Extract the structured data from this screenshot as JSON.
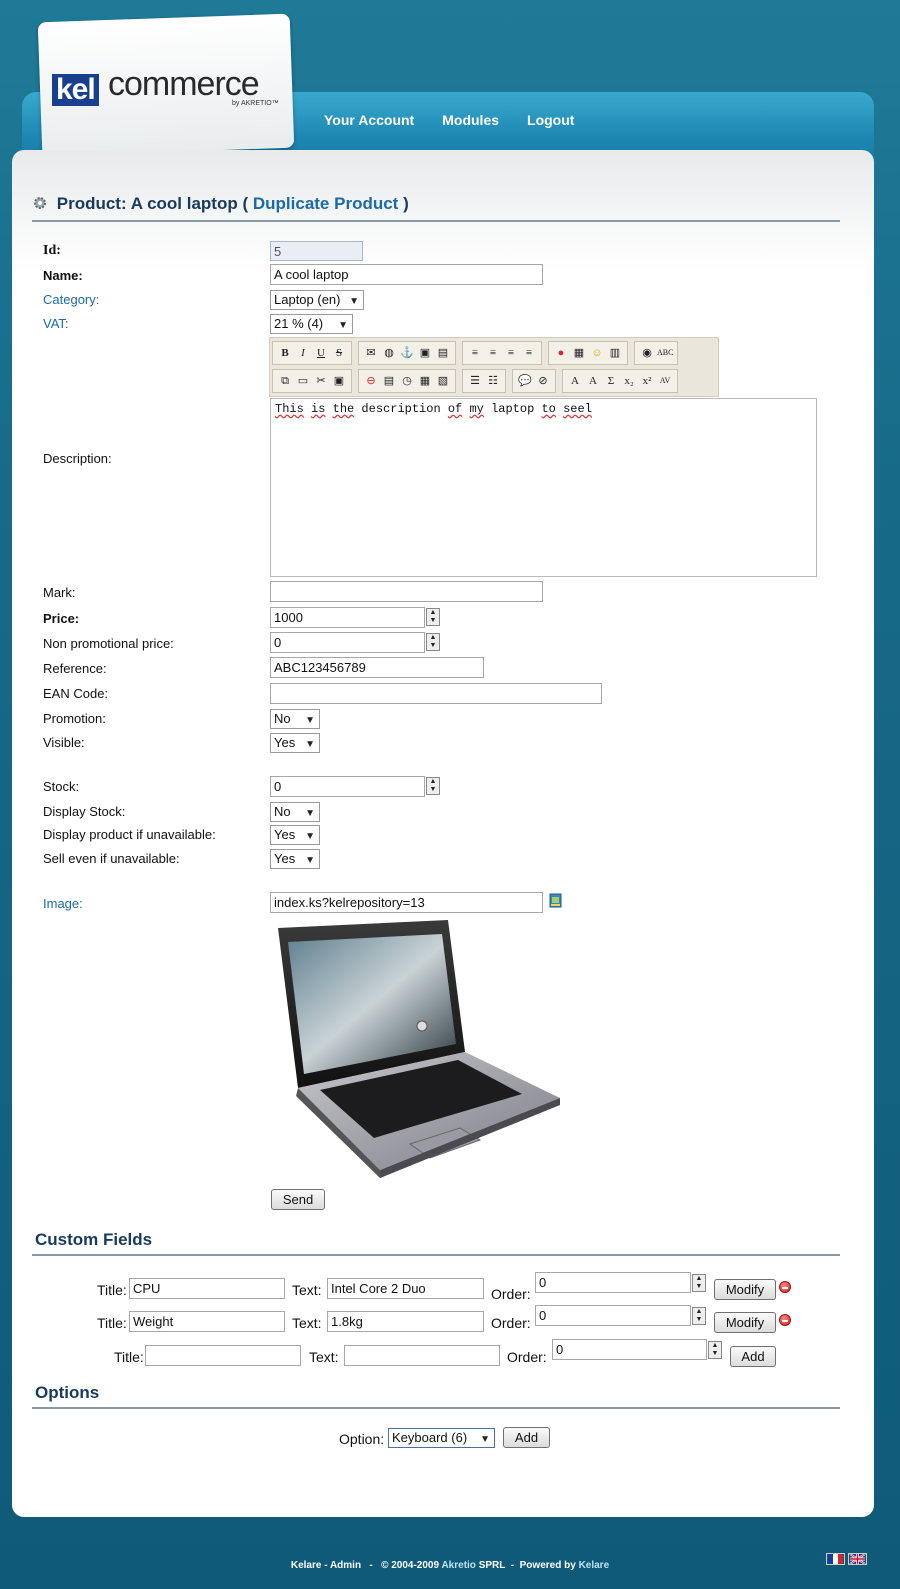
{
  "header": {
    "logo_kel": "kel",
    "logo_commerce": "commerce",
    "logo_by": "by AKRETIO™",
    "nav": [
      "Your Account",
      "Modules",
      "Logout"
    ]
  },
  "title": {
    "prefix": "Product: A cool laptop (",
    "duplicate": "Duplicate Product",
    "suffix": ")"
  },
  "form": {
    "id_label": "Id:",
    "id_value": "5",
    "name_label": "Name:",
    "name_value": "A cool laptop",
    "category_label": "Category:",
    "category_value": "Laptop (en)",
    "vat_label": "VAT:",
    "vat_value": "21 % (4)",
    "description_label": "Description:",
    "description_parts": [
      "This",
      " ",
      "is",
      " ",
      "the",
      " description ",
      "of",
      " ",
      "my",
      " laptop ",
      "to",
      " ",
      "seel"
    ],
    "mark_label": "Mark:",
    "mark_value": "",
    "price_label": "Price:",
    "price_value": "1000",
    "nonpromo_label": "Non promotional price:",
    "nonpromo_value": "0",
    "reference_label": "Reference:",
    "reference_value": "ABC123456789",
    "ean_label": "EAN Code:",
    "ean_value": "",
    "promotion_label": "Promotion:",
    "promotion_value": "No",
    "visible_label": "Visible:",
    "visible_value": "Yes",
    "stock_label": "Stock:",
    "stock_value": "0",
    "display_stock_label": "Display Stock:",
    "display_stock_value": "No",
    "display_unavail_label": "Display product if unavailable:",
    "display_unavail_value": "Yes",
    "sell_unavail_label": "Sell even if unavailable:",
    "sell_unavail_value": "Yes",
    "image_label": "Image:",
    "image_value": "index.ks?kelrepository=13",
    "send": "Send"
  },
  "custom_fields": {
    "title": "Custom Fields",
    "title_label": "Title:",
    "text_label": "Text:",
    "order_label": "Order:",
    "rows": [
      {
        "title": "CPU",
        "text": "Intel Core 2 Duo",
        "order": "0",
        "action": "Modify"
      },
      {
        "title": "Weight",
        "text": "1.8kg",
        "order": "0",
        "action": "Modify"
      },
      {
        "title": "",
        "text": "",
        "order": "0",
        "action": "Add"
      }
    ]
  },
  "options": {
    "title": "Options",
    "option_label": "Option:",
    "option_value": "Keyboard (6)",
    "add": "Add"
  },
  "footer": {
    "left": "Kelare - Admin",
    "copyright": "© 2004-2009",
    "company": "Akretio",
    "company_rest": "SPRL",
    "powered": "Powered by",
    "kelare": "Kelare"
  }
}
